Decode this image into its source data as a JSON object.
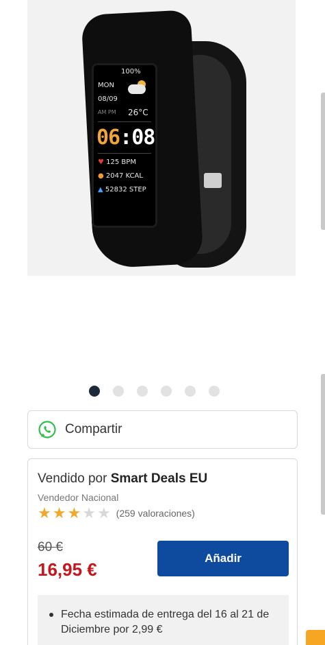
{
  "watch_screen": {
    "battery": "100%",
    "day": "MON",
    "date": "08/09",
    "ampm": "AM PM",
    "temperature": "26°C",
    "time_hours": "06",
    "time_minutes": "08",
    "heart_rate": "125 BPM",
    "calories": "2047 KCAL",
    "steps": "52832 STEP"
  },
  "carousel": {
    "count": 6,
    "active_index": 0
  },
  "share": {
    "label": "Compartir",
    "icon": "whatsapp-icon"
  },
  "seller": {
    "sold_by_prefix": "Vendido por",
    "seller_name": "Smart Deals EU",
    "seller_type": "Vendedor Nacional",
    "rating_stars": 3,
    "rating_max": 5,
    "rating_count": "(259 valoraciones)"
  },
  "pricing": {
    "old_price": "60 €",
    "price": "16,95 €",
    "add_button": "Añadir"
  },
  "delivery": {
    "items": [
      "Fecha estimada de entrega del 16 al 21 de Diciembre por 2,99 €"
    ]
  },
  "colors": {
    "accent_button": "#0e4a9e",
    "price_red": "#c4161c",
    "star_on": "#f0a92a",
    "dot_active": "#1d2a3a"
  }
}
